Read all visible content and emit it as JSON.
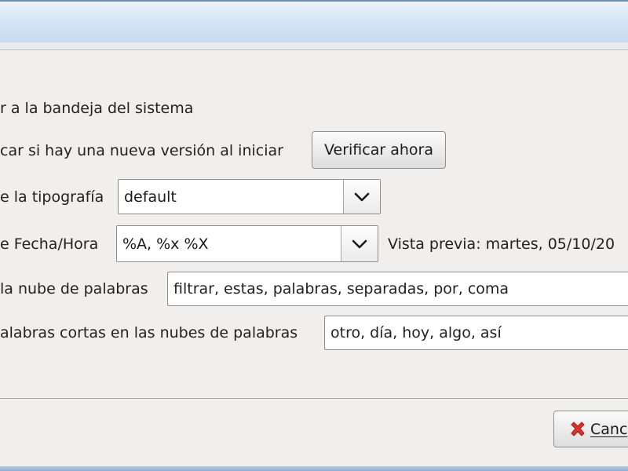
{
  "settings": {
    "tray_label": "r a la bandeja del sistema",
    "check_version_label": "car si hay una nueva versión al iniciar",
    "check_now_button": "Verificar ahora",
    "font_label": "e la tipografía",
    "font_value": "default",
    "datetime_label": "e Fecha/Hora",
    "datetime_value": "%A, %x %X",
    "preview_text": "Vista previa: martes, 05/10/20",
    "wordcloud_filter_label": "la nube de palabras",
    "wordcloud_filter_value": "filtrar, estas, palabras, separadas, por, coma",
    "short_words_label": "alabras cortas en las nubes de palabras",
    "short_words_value": "otro, día, hoy, algo, así"
  },
  "footer": {
    "cancel_button": "Canc"
  },
  "icons": {
    "dropdown": "chevron-down-icon",
    "cancel": "red-x-icon"
  }
}
